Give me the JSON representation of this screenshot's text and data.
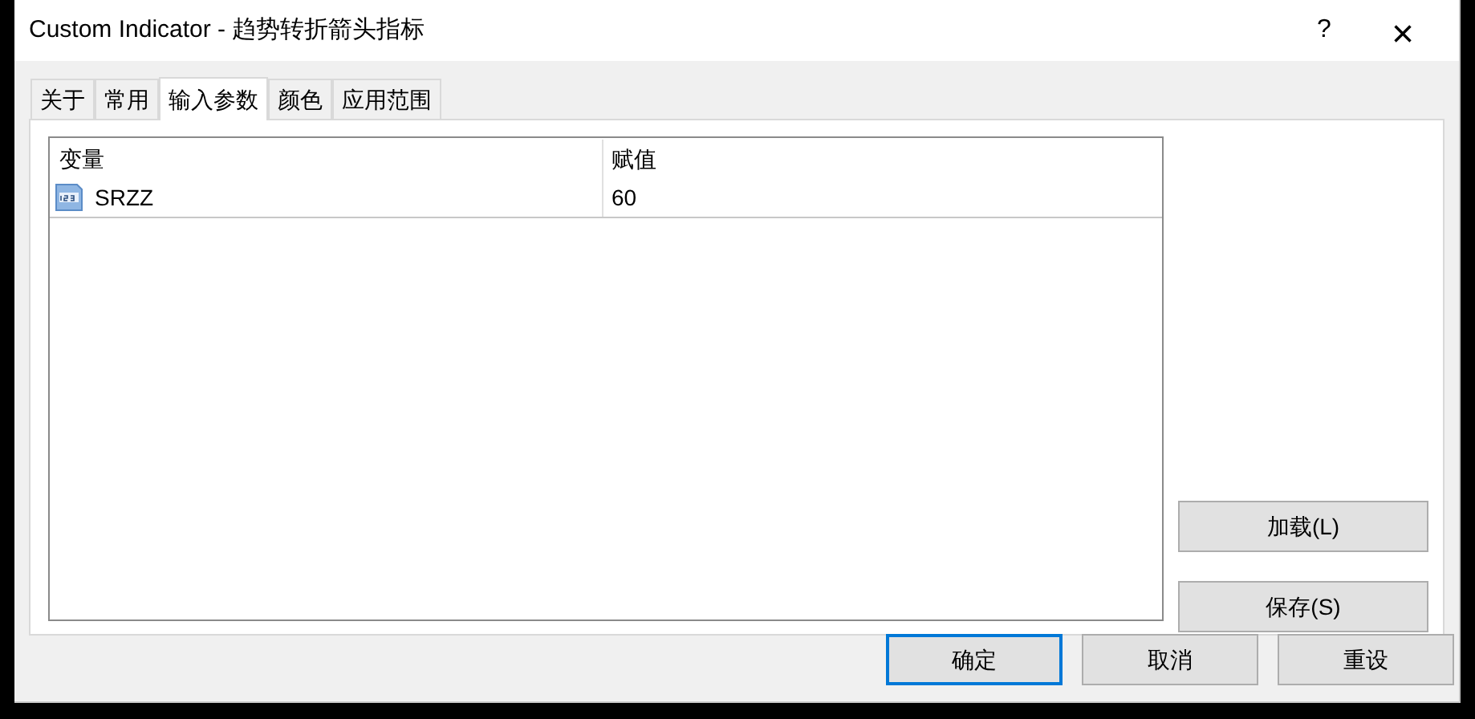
{
  "window": {
    "title": "Custom Indicator - 趋势转折箭头指标",
    "help": "?",
    "close": "×"
  },
  "tabs": [
    {
      "label": "关于",
      "selected": false
    },
    {
      "label": "常用",
      "selected": false
    },
    {
      "label": "输入参数",
      "selected": true
    },
    {
      "label": "颜色",
      "selected": false
    },
    {
      "label": "应用范围",
      "selected": false
    }
  ],
  "table": {
    "columns": [
      "变量",
      "赋值"
    ],
    "rows": [
      {
        "kind": "number",
        "name": "SRZZ",
        "value": "60"
      }
    ]
  },
  "side_buttons": [
    "加载(L)",
    "保存(S)"
  ],
  "footer_buttons": [
    {
      "label": "确定",
      "focused": true
    },
    {
      "label": "取消",
      "focused": false
    },
    {
      "label": "重设",
      "focused": false
    }
  ]
}
